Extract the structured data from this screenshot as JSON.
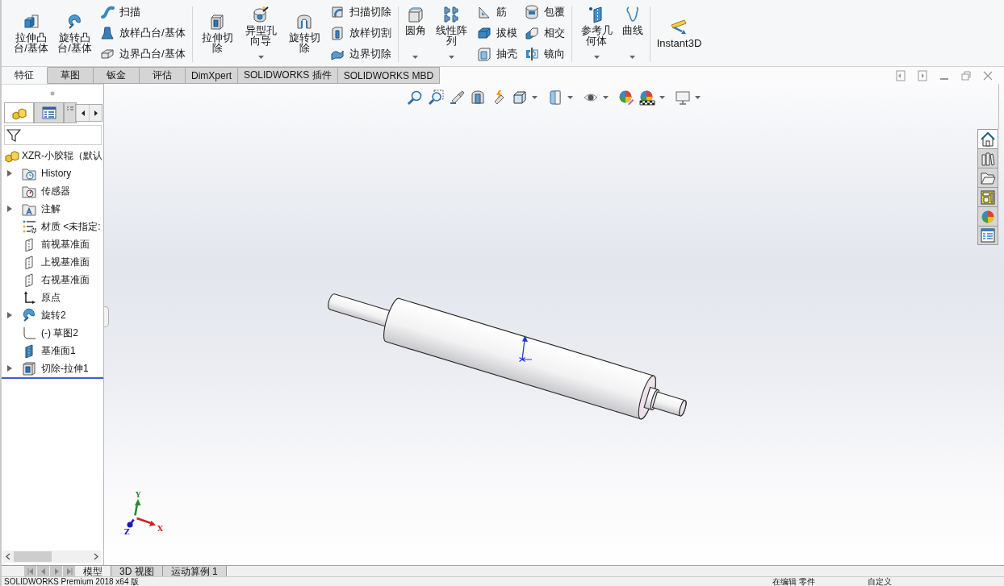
{
  "command_manager": {
    "groups": [
      {
        "buttons": [
          {
            "label": "拉伸凸台/基体",
            "has_menu": false
          },
          {
            "label": "旋转凸台/基体",
            "has_menu": false
          }
        ],
        "columns": [
          [
            "扫描",
            "放样凸台/基体",
            "边界凸台/基体"
          ]
        ]
      },
      {
        "buttons": [
          {
            "label": "拉伸切除",
            "has_menu": false
          },
          {
            "label": "异型孔向导",
            "has_menu": true
          },
          {
            "label": "旋转切除",
            "has_menu": false
          }
        ],
        "columns": [
          [
            "扫描切除",
            "放样切割",
            "边界切除"
          ]
        ]
      },
      {
        "buttons": [
          {
            "label": "圆角",
            "has_menu": true
          },
          {
            "label": "线性阵列",
            "has_menu": true
          }
        ],
        "columns": [
          [
            "筋",
            "拔模",
            "抽壳"
          ],
          [
            "包覆",
            "相交",
            "镜向"
          ]
        ]
      },
      {
        "buttons": [
          {
            "label": "参考几何体",
            "has_menu": true
          },
          {
            "label": "曲线",
            "has_menu": true
          }
        ]
      },
      {
        "buttons": [
          {
            "label": "Instant3D",
            "has_menu": false
          }
        ]
      }
    ]
  },
  "tabs": [
    {
      "label": "特征",
      "selected": true
    },
    {
      "label": "草图",
      "selected": false
    },
    {
      "label": "钣金",
      "selected": false
    },
    {
      "label": "评估",
      "selected": false
    },
    {
      "label": "DimXpert",
      "selected": false
    },
    {
      "label": "SOLIDWORKS 插件",
      "selected": false
    },
    {
      "label": "SOLIDWORKS MBD",
      "selected": false
    }
  ],
  "feature_manager": {
    "panel_tabs": [
      {
        "selected": true
      },
      {
        "selected": false
      },
      {
        "selected": false
      }
    ],
    "tree": {
      "kind": "part",
      "label": "XZR-小胶辊（默认",
      "children": [
        {
          "kind": "history",
          "label": "History",
          "expandable": true
        },
        {
          "kind": "sensors",
          "label": "传感器",
          "expandable": false
        },
        {
          "kind": "annotations",
          "label": "注解",
          "expandable": true
        },
        {
          "kind": "material",
          "label": "材质 <未指定:",
          "expandable": false
        },
        {
          "kind": "plane",
          "label": "前视基准面",
          "expandable": false
        },
        {
          "kind": "plane",
          "label": "上视基准面",
          "expandable": false
        },
        {
          "kind": "plane",
          "label": "右视基准面",
          "expandable": false
        },
        {
          "kind": "origin",
          "label": "原点",
          "expandable": false
        },
        {
          "kind": "revolve",
          "label": "旋转2",
          "expandable": true
        },
        {
          "kind": "sketch",
          "label": "(-) 草图2",
          "expandable": false
        },
        {
          "kind": "datum-plane",
          "label": "基准面1",
          "expandable": false
        },
        {
          "kind": "cut-extrude",
          "label": "切除-拉伸1",
          "expandable": true
        }
      ]
    }
  },
  "graphics": {
    "triad": {
      "x": "X",
      "y": "Y",
      "z": "Z"
    }
  },
  "task_pane": [
    {
      "selected": true
    },
    {
      "selected": false
    },
    {
      "selected": false
    },
    {
      "selected": false
    },
    {
      "selected": false
    },
    {
      "selected": false
    }
  ],
  "model_tabs": [
    {
      "label": "模型",
      "selected": true
    },
    {
      "label": "3D 视图",
      "selected": false
    },
    {
      "label": "运动算例 1",
      "selected": false
    }
  ],
  "status_bar": {
    "product": "SOLIDWORKS Premium 2018 x64 版",
    "mode": "在编辑 零件",
    "units": "自定义"
  }
}
